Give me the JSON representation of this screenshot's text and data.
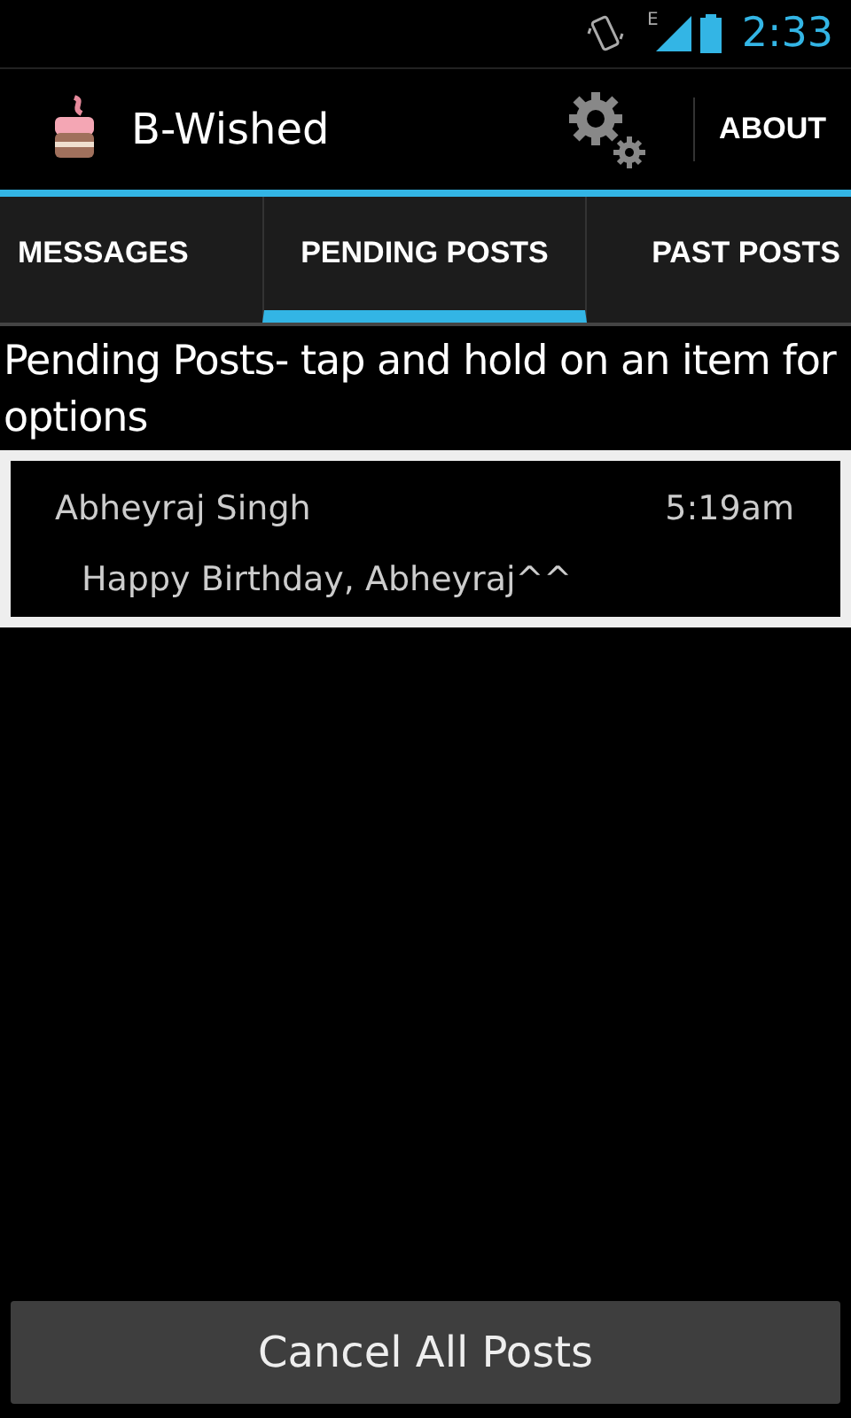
{
  "status_bar": {
    "time": "2:33",
    "network": "E"
  },
  "action_bar": {
    "title": "B-Wished",
    "about": "ABOUT"
  },
  "tabs": [
    {
      "label": "MESSAGES",
      "selected": false
    },
    {
      "label": "PENDING POSTS",
      "selected": true
    },
    {
      "label": "PAST POSTS",
      "selected": false
    }
  ],
  "heading": "Pending Posts- tap and hold on an item for options",
  "posts": [
    {
      "name": "Abheyraj Singh",
      "time": "5:19am",
      "message": "Happy Birthday, Abheyraj^^"
    }
  ],
  "cancel_button": "Cancel All Posts"
}
